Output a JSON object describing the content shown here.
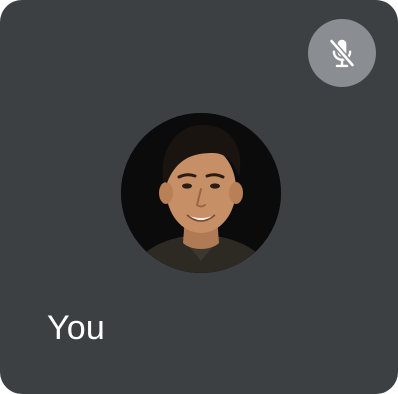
{
  "participant": {
    "name": "You",
    "mic_status_icon": "mic-off-icon",
    "avatar_alt": "photo"
  },
  "colors": {
    "tile_background": "#3c4043",
    "badge_background": "#8a8d91",
    "name_text": "#ffffff"
  }
}
